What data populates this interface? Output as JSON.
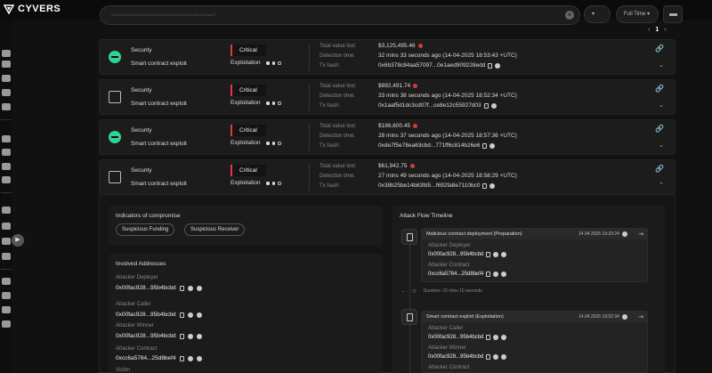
{
  "app": {
    "brand": "CYVERS"
  },
  "search": {
    "value": "0x00fac92800b5b4bcbd0e1aed909228edd0d3d3fb56b3aef3"
  },
  "filters": {
    "type_label": "▾",
    "time_label": "Full Time ▾"
  },
  "pager": {
    "prev": "‹",
    "page": "1",
    "next": "›"
  },
  "colors": {
    "critical": "#e53945",
    "accent_green": "#32d296",
    "bg": "#111111"
  },
  "alerts": [
    {
      "icon": "token-green-circle-icon",
      "category": "Security",
      "type": "Smart contract exploit",
      "severity": "Critical",
      "stage": "Exploitation",
      "stage_dots": [
        true,
        false,
        false
      ],
      "value_lost": "$3,125,495.46",
      "detection": "32 mins 33 seconds ago (14-04-2025 18:53:43 +UTC)",
      "tx_hash": "0x6b378c84aa57097...0e1aed909228edd",
      "labels": {
        "value": "Total value lost:",
        "detection": "Detection time:",
        "tx": "Tx hash:"
      }
    },
    {
      "icon": "cube-icon",
      "category": "Security",
      "type": "Smart contract exploit",
      "severity": "Critical",
      "stage": "Exploitation",
      "stage_dots": [
        true,
        false,
        false
      ],
      "value_lost": "$892,491.74",
      "detection": "33 mins 38 seconds ago (14-04-2025 18:52:34 +UTC)",
      "tx_hash": "0x1aaf5d1dc3cd07f...ce8e12c55927d03",
      "labels": {
        "value": "Total value lost:",
        "detection": "Detection time:",
        "tx": "Tx hash:"
      }
    },
    {
      "icon": "token-green-circle-icon",
      "category": "Security",
      "type": "Smart contract exploit",
      "severity": "Critical",
      "stage": "Exploitation",
      "stage_dots": [
        true,
        false,
        false
      ],
      "value_lost": "$186,600.45",
      "detection": "28 mins 37 seconds ago (14-04-2025 18:57:36 +UTC)",
      "tx_hash": "0xde7f5e78ea63cbd...771ff6c814b26e6",
      "labels": {
        "value": "Total value lost:",
        "detection": "Detection time:",
        "tx": "Tx hash:"
      }
    },
    {
      "icon": "cube-icon",
      "category": "Security",
      "type": "Smart contract exploit",
      "severity": "Critical",
      "stage": "Exploitation",
      "stage_dots": [
        true,
        false,
        false
      ],
      "value_lost": "$61,942.75",
      "detection": "27 mins 49 seconds ago (14-04-2025 18:58:29 +UTC)",
      "tx_hash": "0x38b25be14b83fd5...f692fa8e7110bc0",
      "labels": {
        "value": "Total value lost:",
        "detection": "Detection time:",
        "tx": "Tx hash:"
      }
    }
  ],
  "ioc": {
    "title": "Indicators of compromise",
    "chips": [
      "Suspicious Funding",
      "Suspicious Receiver"
    ]
  },
  "involved": {
    "title": "Involved Addresses",
    "items": [
      {
        "label": "Attacker Deployer",
        "address": "0x00fac928...95b4bcbd"
      },
      {
        "label": "Attacker Caller",
        "address": "0x00fac928...95b4bcbd"
      },
      {
        "label": "Attacker Winner",
        "address": "0x00fac928...95b4bcbd"
      },
      {
        "label": "Attacker Contract",
        "address": "0xcc6a5784...25d8bef4"
      },
      {
        "label": "Victim",
        "address": ""
      }
    ]
  },
  "timeline": {
    "title": "Attack Flow Timeline",
    "steps": [
      {
        "name": "Malicious contract deployment  (Preparation)",
        "time": "14.04.2025 18:29:24",
        "rows": [
          {
            "label": "Attacker Deployer",
            "address": "0x00fac928...95b4bcbd"
          },
          {
            "label": "Attacker Contract",
            "address": "0xcc6a5784...25d8bef4"
          }
        ]
      },
      {
        "name": "Smart contract exploit  (Exploitation)",
        "time": "14.04.2025 18:52:34",
        "rows": [
          {
            "label": "Attacker Caller",
            "address": "0x00fac928...95b4bcbd"
          },
          {
            "label": "Attacker Winner",
            "address": "0x00fac928...95b4bcbd"
          },
          {
            "label": "Attacker Contract",
            "address": ""
          }
        ]
      }
    ],
    "duration": "Duration: 23 mins 10 seconds"
  }
}
